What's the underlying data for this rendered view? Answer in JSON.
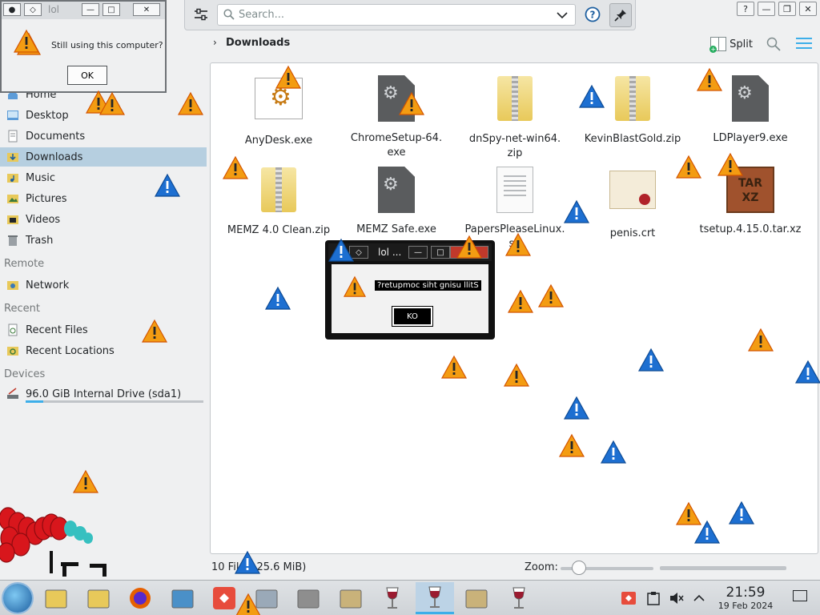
{
  "toolbar": {
    "search_placeholder": "Search...",
    "help_icon": "help-icon",
    "pin_icon": "pin-icon"
  },
  "breadcrumb": {
    "current": "Downloads"
  },
  "header_actions": {
    "split_label": "Split"
  },
  "sidebar": {
    "places": [
      {
        "label": "Home",
        "icon": "home-icon"
      },
      {
        "label": "Desktop",
        "icon": "desktop-icon"
      },
      {
        "label": "Documents",
        "icon": "documents-icon"
      },
      {
        "label": "Downloads",
        "icon": "downloads-icon",
        "active": true
      },
      {
        "label": "Music",
        "icon": "music-icon"
      },
      {
        "label": "Pictures",
        "icon": "pictures-icon"
      },
      {
        "label": "Videos",
        "icon": "videos-icon"
      },
      {
        "label": "Trash",
        "icon": "trash-icon"
      }
    ],
    "remote_heading": "Remote",
    "remote": [
      {
        "label": "Network",
        "icon": "network-icon"
      }
    ],
    "recent_heading": "Recent",
    "recent": [
      {
        "label": "Recent Files",
        "icon": "recent-files-icon"
      },
      {
        "label": "Recent Locations",
        "icon": "recent-locations-icon"
      }
    ],
    "devices_heading": "Devices",
    "devices": [
      {
        "label": "96.0 GiB Internal Drive (sda1)",
        "icon": "drive-icon",
        "usage_fraction": 0.1
      }
    ]
  },
  "files": [
    {
      "name": "AnyDesk.exe",
      "type": "anydesk"
    },
    {
      "name": "ChromeSetup-64.\nexe",
      "type": "exe"
    },
    {
      "name": "dnSpy-net-win64.\nzip",
      "type": "zip"
    },
    {
      "name": "KevinBlastGold.zip",
      "type": "zip"
    },
    {
      "name": "LDPlayer9.exe",
      "type": "exe"
    },
    {
      "name": "MEMZ 4.0 Clean.zip",
      "type": "zip"
    },
    {
      "name": "MEMZ Safe.exe",
      "type": "exe"
    },
    {
      "name": "PapersPleaseLinux.\nsh",
      "type": "script"
    },
    {
      "name": "penis.crt",
      "type": "cert"
    },
    {
      "name": "tsetup.4.15.0.tar.xz",
      "type": "tar"
    }
  ],
  "status": {
    "count_prefix": "10 Fil",
    "count_suffix": "25.6 MiB)",
    "zoom_label": "Zoom:",
    "zoom_level": 0.2
  },
  "dialog_top_left": {
    "title": "lol",
    "message": "Still using this computer?",
    "ok": "OK"
  },
  "dialog_center": {
    "title": "lol ...",
    "message": "?retupmoc siht gnisu llitS",
    "ok": "KO"
  },
  "taskbar": {
    "apps": [
      {
        "name": "file-manager-icon"
      },
      {
        "name": "file-manager-icon"
      },
      {
        "name": "firefox-icon"
      },
      {
        "name": "remote-desktop-icon"
      },
      {
        "name": "anydesk-icon"
      },
      {
        "name": "disk-utility-icon"
      },
      {
        "name": "wine-app-icon"
      },
      {
        "name": "wine-notepad-icon"
      },
      {
        "name": "wine-glass-icon"
      },
      {
        "name": "wine-glass-icon",
        "active": true
      },
      {
        "name": "wine-notepad-icon"
      },
      {
        "name": "wine-glass-icon"
      }
    ],
    "time": "21:59",
    "date": "19 Feb 2024"
  },
  "colors": {
    "accent": "#3daee9",
    "warning_orange": "#f39c12",
    "info_blue": "#1d6fd1",
    "selection": "#b6cfe0"
  }
}
